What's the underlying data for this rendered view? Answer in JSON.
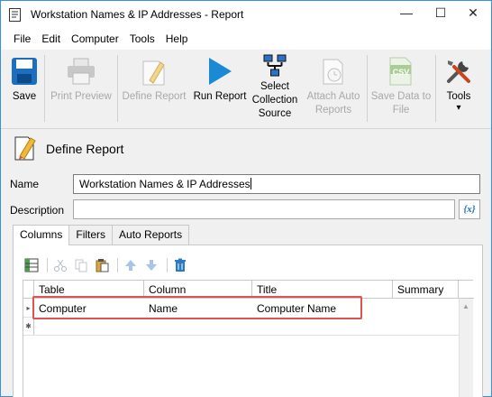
{
  "window": {
    "title": "Workstation Names & IP Addresses - Report",
    "min_glyph": "—",
    "max_glyph": "☐",
    "close_glyph": "✕"
  },
  "menu": [
    "File",
    "Edit",
    "Computer",
    "Tools",
    "Help"
  ],
  "toolbar": {
    "save": "Save",
    "print_preview": "Print Preview",
    "define_report": "Define Report",
    "run_report": "Run Report",
    "select_collection_source_1": "Select",
    "select_collection_source_2": "Collection",
    "select_collection_source_3": "Source",
    "attach_auto_reports_1": "Attach Auto",
    "attach_auto_reports_2": "Reports",
    "save_data_to_file_1": "Save Data to",
    "save_data_to_file_2": "File",
    "csv_badge": "CSV",
    "tools": "Tools",
    "tools_arrow": "▾"
  },
  "section": {
    "title": "Define Report"
  },
  "form": {
    "name_label": "Name",
    "name_value": "Workstation Names & IP Addresses",
    "description_label": "Description",
    "description_value": "",
    "fx_label": "{x}"
  },
  "tabs": [
    {
      "label": "Columns",
      "active": true
    },
    {
      "label": "Filters",
      "active": false
    },
    {
      "label": "Auto Reports",
      "active": false
    }
  ],
  "grid": {
    "columns": [
      "Table",
      "Column",
      "Title",
      "Summary"
    ],
    "rows": [
      {
        "marker": "▸",
        "table": "Computer",
        "column": "Name",
        "title": "Computer Name",
        "summary": ""
      }
    ],
    "new_row_marker": "✱",
    "scroll_up": "▲"
  },
  "colors": {
    "accent": "#1c6fc0",
    "run_report_blue": "#1a8ad4",
    "highlight": "#e05252",
    "disabled_text": "#a8a8a8"
  }
}
